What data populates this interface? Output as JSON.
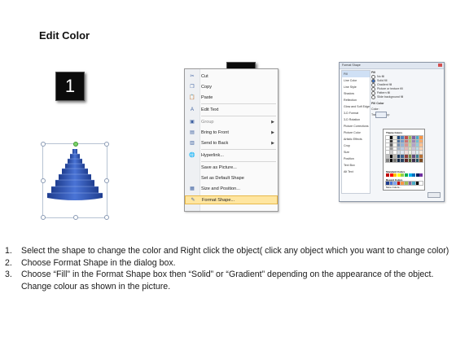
{
  "title": "Edit Color",
  "steps": [
    {
      "number": "1"
    },
    {
      "number": "2"
    },
    {
      "number": "3"
    }
  ],
  "context_menu": {
    "items": [
      {
        "label": "Cut",
        "icon": "scissors-icon",
        "glyph": "✂"
      },
      {
        "label": "Copy",
        "icon": "copy-icon",
        "glyph": "❐"
      },
      {
        "label": "Paste",
        "icon": "paste-icon",
        "glyph": "📋"
      },
      {
        "label": "Edit Text",
        "icon": "edit-text-icon",
        "glyph": "A"
      },
      {
        "label": "Group",
        "icon": "group-icon",
        "glyph": "▣",
        "submenu": true
      },
      {
        "label": "Bring to Front",
        "icon": "bring-to-front-icon",
        "glyph": "▤",
        "submenu": true
      },
      {
        "label": "Send to Back",
        "icon": "send-to-back-icon",
        "glyph": "▥",
        "submenu": true
      },
      {
        "label": "Hyperlink...",
        "icon": "hyperlink-icon",
        "glyph": "🌐"
      },
      {
        "label": "Save as Picture...",
        "icon": "",
        "glyph": ""
      },
      {
        "label": "Set as Default Shape",
        "icon": "",
        "glyph": ""
      },
      {
        "label": "Size and Position...",
        "icon": "size-position-icon",
        "glyph": "▦"
      },
      {
        "label": "Format Shape...",
        "icon": "format-shape-icon",
        "glyph": "✎",
        "highlighted": true
      }
    ]
  },
  "dialog": {
    "title": "Format Shape",
    "categories": [
      "Fill",
      "Line Color",
      "Line Style",
      "Shadow",
      "Reflection",
      "Glow and Soft Edges",
      "3-D Format",
      "3-D Rotation",
      "Picture Corrections",
      "Picture Color",
      "Artistic Effects",
      "Crop",
      "Size",
      "Position",
      "Text Box",
      "Alt Text"
    ],
    "section": "Fill",
    "fill_options": [
      "No fill",
      "Solid fill",
      "Gradient fill",
      "Picture or texture fill",
      "Pattern fill",
      "Slide background fill"
    ],
    "fill_color_label": "Fill Color",
    "color_label": "Color:",
    "transparency_label": "Transparency:",
    "palette_theme_label": "Theme Colors",
    "palette_standard_label": "Standard Colors",
    "palette_recent_label": "Recent Colors",
    "palette_more_label": "More Colors...",
    "close_label": "Close"
  },
  "instructions": [
    {
      "num": "1.",
      "text": "Select the shape to change the color and Right click the object( click any object which you want to change color)"
    },
    {
      "num": "2.",
      "text": "Choose Format Shape in the dialog box."
    },
    {
      "num": "3.",
      "text": "Choose “Fill” in the Format Shape box then “Solid” or “Gradient” depending on the appearance of the object. Change colour as shown in the picture."
    }
  ],
  "colors": {
    "badge_bg": "#0b0b0b",
    "pyramid_dark": "#1f3d8f",
    "pyramid_light": "#7fa6ef",
    "menu_highlight": "#ffe6a0"
  }
}
